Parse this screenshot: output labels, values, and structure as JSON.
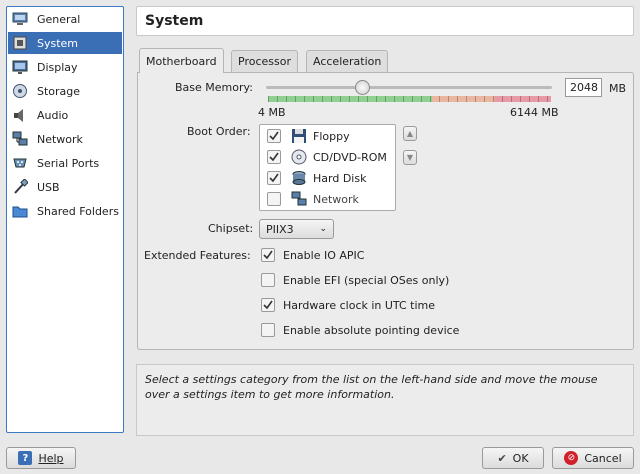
{
  "sidebar": {
    "items": [
      {
        "label": "General",
        "icon": "general-icon"
      },
      {
        "label": "System",
        "icon": "system-icon",
        "selected": true
      },
      {
        "label": "Display",
        "icon": "display-icon"
      },
      {
        "label": "Storage",
        "icon": "storage-icon"
      },
      {
        "label": "Audio",
        "icon": "audio-icon"
      },
      {
        "label": "Network",
        "icon": "network-icon"
      },
      {
        "label": "Serial Ports",
        "icon": "serial-ports-icon"
      },
      {
        "label": "USB",
        "icon": "usb-icon"
      },
      {
        "label": "Shared Folders",
        "icon": "shared-folders-icon"
      }
    ]
  },
  "header": {
    "title": "System"
  },
  "tabs": [
    {
      "label": "Motherboard",
      "active": true
    },
    {
      "label": "Processor"
    },
    {
      "label": "Acceleration"
    }
  ],
  "motherboard": {
    "base_memory_label": "Base Memory:",
    "base_memory_value": "2048",
    "base_memory_unit": "MB",
    "slider_min_label": "4 MB",
    "slider_max_label": "6144 MB",
    "slider_fraction": 0.333,
    "boot_order_label": "Boot Order:",
    "boot_items": [
      {
        "label": "Floppy",
        "checked": true,
        "icon": "floppy-icon"
      },
      {
        "label": "CD/DVD-ROM",
        "checked": true,
        "icon": "cd-dvd-icon"
      },
      {
        "label": "Hard Disk",
        "checked": true,
        "icon": "hard-disk-icon"
      },
      {
        "label": "Network",
        "checked": false,
        "icon": "network-boot-icon"
      }
    ],
    "chipset_label": "Chipset:",
    "chipset_value": "PIIX3",
    "extended_features_label": "Extended Features:",
    "features": [
      {
        "label": "Enable IO APIC",
        "checked": true
      },
      {
        "label": "Enable EFI (special OSes only)",
        "checked": false
      },
      {
        "label": "Hardware clock in UTC time",
        "checked": true
      },
      {
        "label": "Enable absolute pointing device",
        "checked": false
      }
    ]
  },
  "info_text": "Select a settings category from the list on the left-hand side and move the mouse over a settings item to get more information.",
  "buttons": {
    "help": "Help",
    "ok": "OK",
    "cancel": "Cancel"
  },
  "colors": {
    "accent": "#3b6fb5",
    "slider_green": "#7fc97f",
    "slider_red": "#e88a8a"
  }
}
